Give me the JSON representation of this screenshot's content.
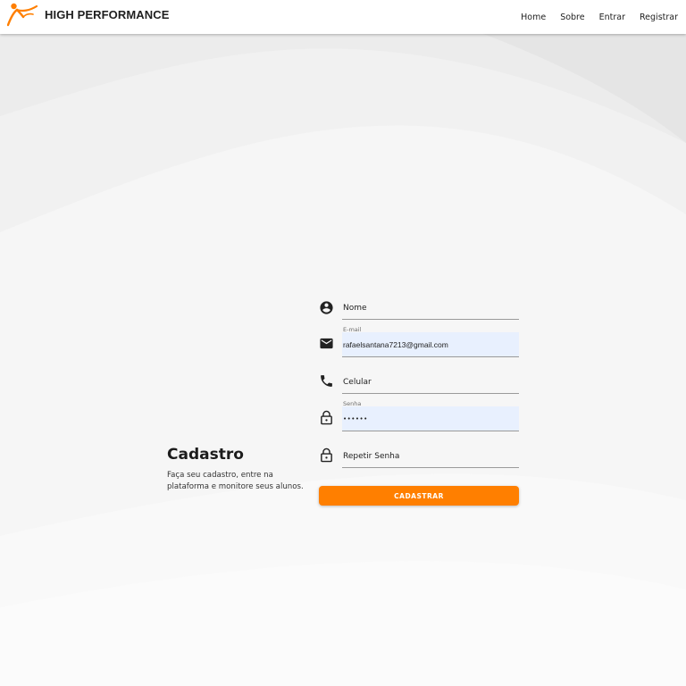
{
  "brand": {
    "name": "HIGH PERFORMANCE",
    "logo_icon": "running-figure-logo",
    "accent_color": "#ff7f00"
  },
  "nav": {
    "items": [
      "Home",
      "Sobre",
      "Entrar",
      "Registrar"
    ]
  },
  "intro": {
    "title": "Cadastro",
    "description": "Faça seu cadastro, entre na plataforma e monitore seus alunos."
  },
  "form": {
    "nome": {
      "icon": "account-circle-icon",
      "placeholder": "Nome",
      "value": ""
    },
    "email": {
      "icon": "mail-icon",
      "label": "E-mail",
      "value": "rafaelsantana7213@gmail.com"
    },
    "celular": {
      "icon": "phone-icon",
      "placeholder": "Celular",
      "value": ""
    },
    "senha": {
      "icon": "lock-icon",
      "label": "Senha",
      "value": "••••••"
    },
    "repetir_senha": {
      "icon": "lock-icon",
      "placeholder": "Repetir Senha",
      "value": ""
    },
    "submit_label": "CADASTRAR"
  }
}
